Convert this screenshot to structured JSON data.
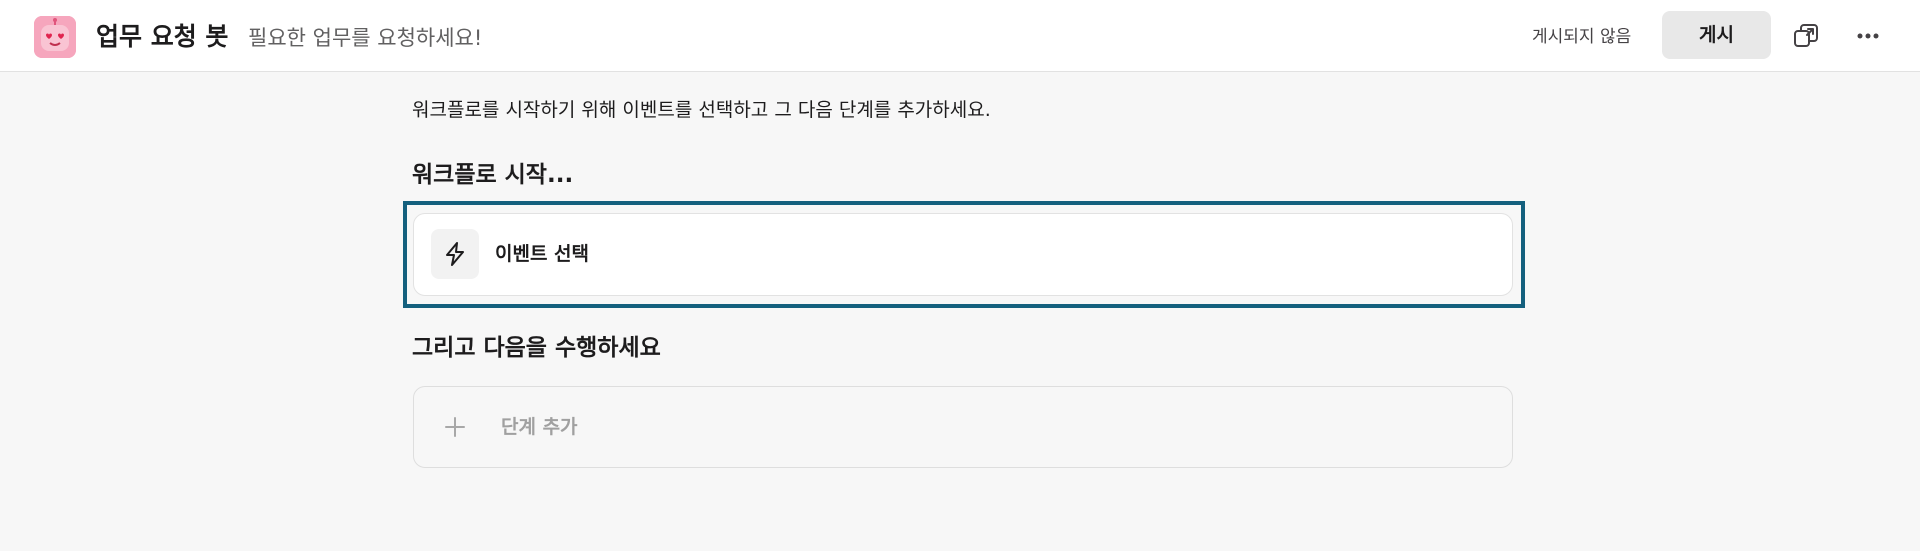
{
  "header": {
    "app_icon": "robot-heart-eyes-icon",
    "title": "업무 요청 봇",
    "subtitle": "필요한 업무를 요청하세요!",
    "status": "게시되지 않음",
    "publish_label": "게시",
    "share_icon": "share-copy-icon",
    "more_icon": "more-horizontal-icon"
  },
  "main": {
    "intro": "워크플로를 시작하기 위해 이벤트를 선택하고 그 다음 단계를 추가하세요.",
    "start_heading": "워크플로 시작...",
    "trigger": {
      "icon": "lightning-icon",
      "label": "이벤트 선택"
    },
    "then_heading": "그리고 다음을 수행하세요",
    "add_step": {
      "icon": "plus-icon",
      "label": "단계 추가"
    }
  },
  "colors": {
    "focus_border": "#14607e",
    "app_icon_bg": "#f6a6bd"
  }
}
